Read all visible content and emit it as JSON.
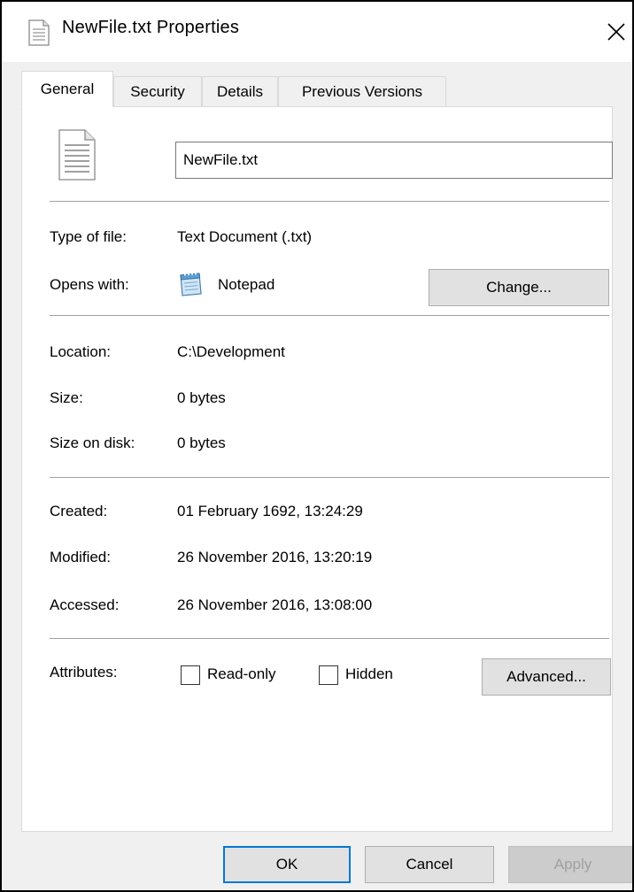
{
  "window": {
    "title": "NewFile.txt Properties"
  },
  "tabs": [
    {
      "label": "General",
      "active": true
    },
    {
      "label": "Security",
      "active": false
    },
    {
      "label": "Details",
      "active": false
    },
    {
      "label": "Previous Versions",
      "active": false
    }
  ],
  "general": {
    "file_name": "NewFile.txt",
    "type_of_file": {
      "label": "Type of file:",
      "value": "Text Document (.txt)"
    },
    "opens_with": {
      "label": "Opens with:",
      "value": "Notepad",
      "change_label": "Change..."
    },
    "location": {
      "label": "Location:",
      "value": "C:\\Development"
    },
    "size": {
      "label": "Size:",
      "value": "0 bytes"
    },
    "size_on_disk": {
      "label": "Size on disk:",
      "value": "0 bytes"
    },
    "created": {
      "label": "Created:",
      "value": "01 February 1692, 13:24:29"
    },
    "modified": {
      "label": "Modified:",
      "value": "26 November 2016, 13:20:19"
    },
    "accessed": {
      "label": "Accessed:",
      "value": "26 November 2016, 13:08:00"
    },
    "attributes": {
      "label": "Attributes:",
      "read_only": {
        "label": "Read-only",
        "checked": false
      },
      "hidden": {
        "label": "Hidden",
        "checked": false
      },
      "advanced_label": "Advanced..."
    }
  },
  "footer": {
    "ok_label": "OK",
    "cancel_label": "Cancel",
    "apply_label": "Apply"
  },
  "icons": {
    "title": "text-document-icon",
    "close": "close-icon",
    "file": "text-document-icon",
    "opens_with": "notepad-icon"
  },
  "colors": {
    "dialog_background": "#f0f0f0",
    "panel_background": "#ffffff",
    "default_button_border": "#0078d7",
    "button_face": "#e1e1e1",
    "disabled_text": "#a0a0a0"
  }
}
